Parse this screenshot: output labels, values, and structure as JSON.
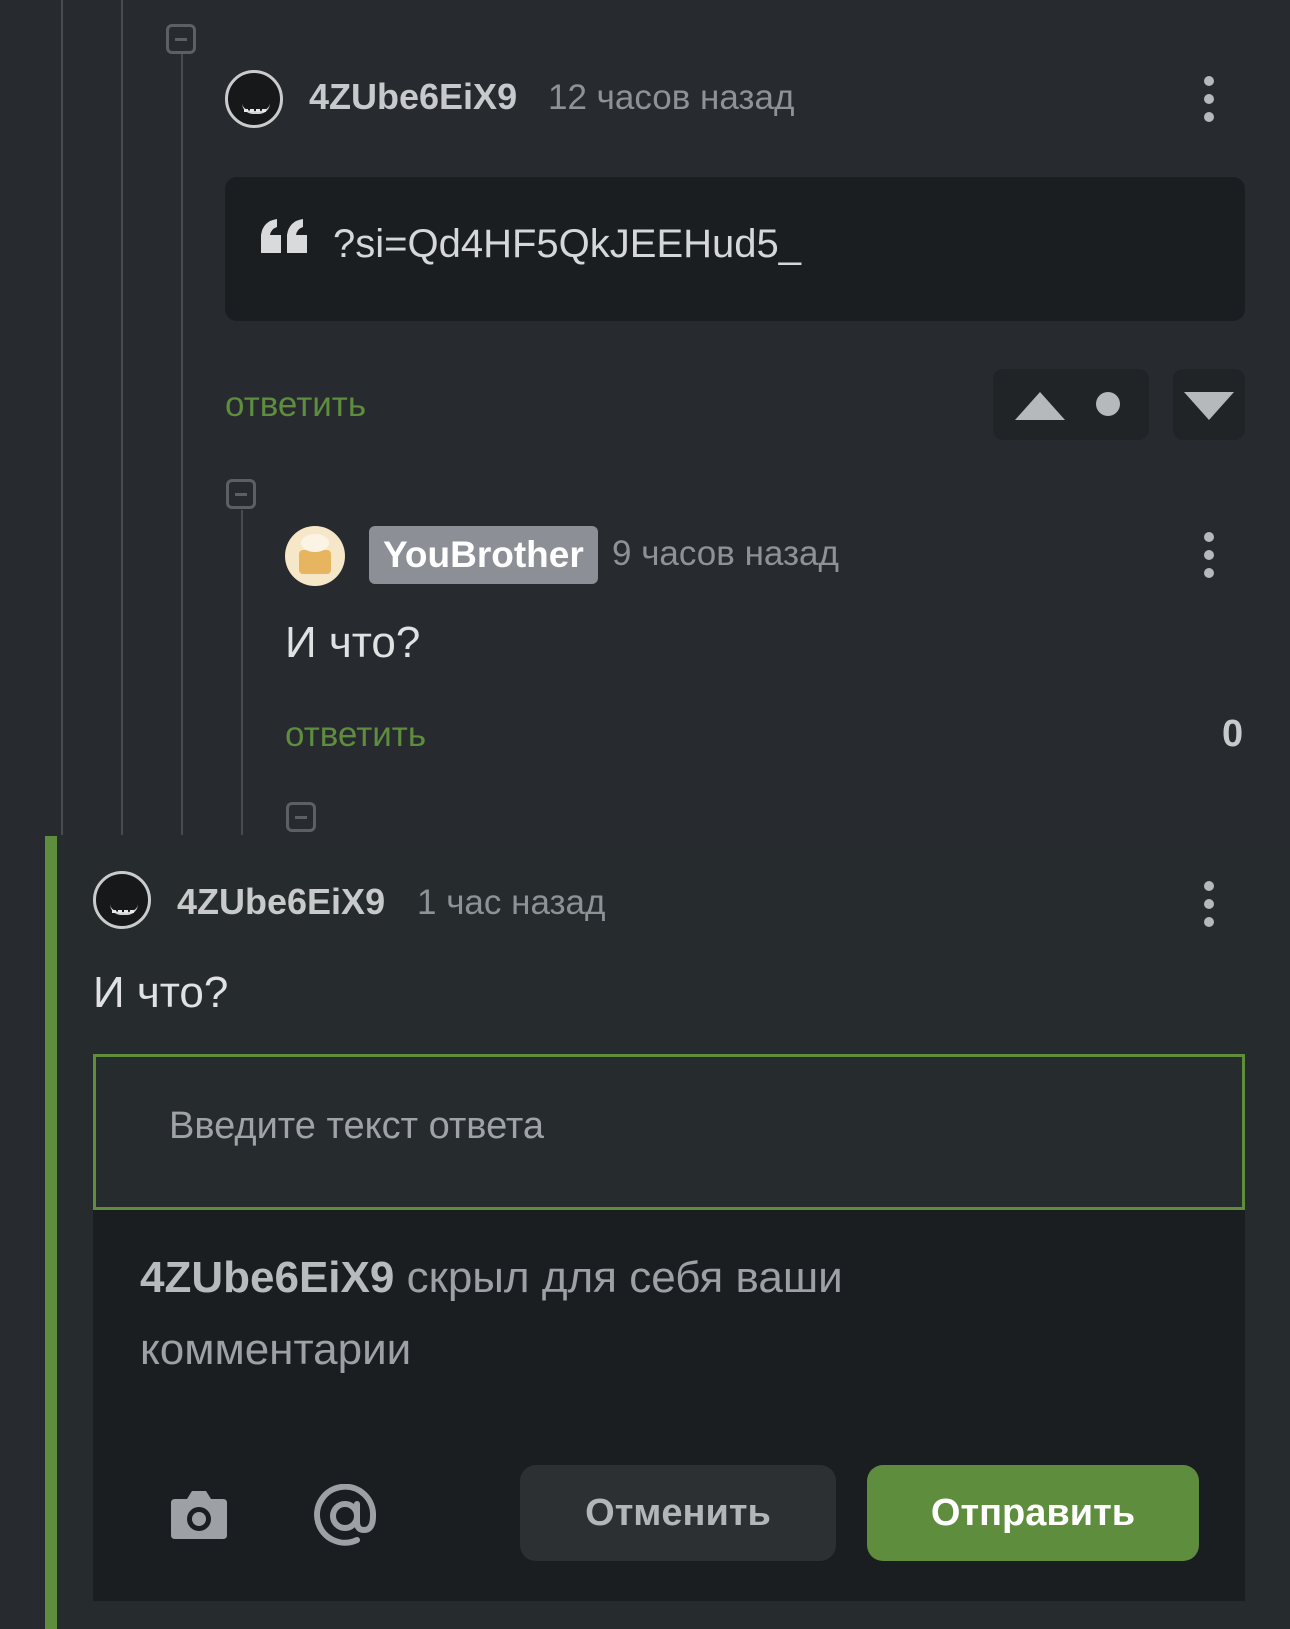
{
  "thread": {
    "comment1": {
      "username": "4ZUbe6EiX9",
      "time": "12 часов назад",
      "quote": "?si=Qd4HF5QkJEEHud5_",
      "reply": "ответить"
    },
    "comment2": {
      "username": "YouBrother",
      "time": "9 часов назад",
      "text": "И что?",
      "reply": "ответить",
      "rating": "0"
    }
  },
  "active": {
    "username": "4ZUbe6EiX9",
    "time": "1 час назад",
    "text": "И что?",
    "input_placeholder": "Введите текст ответа",
    "notice_user": "4ZUbe6EiX9",
    "notice_text": " скрыл для себя ваши комментарии",
    "cancel_label": "Отменить",
    "send_label": "Отправить"
  },
  "colors": {
    "accent": "#5f8d3e",
    "background": "#272b2f",
    "panel": "#1b1e21"
  },
  "icons": [
    "collapse-icon",
    "avatar",
    "kebab-icon",
    "quote-icon",
    "upvote-icon",
    "downvote-icon",
    "camera-icon",
    "at-icon"
  ]
}
